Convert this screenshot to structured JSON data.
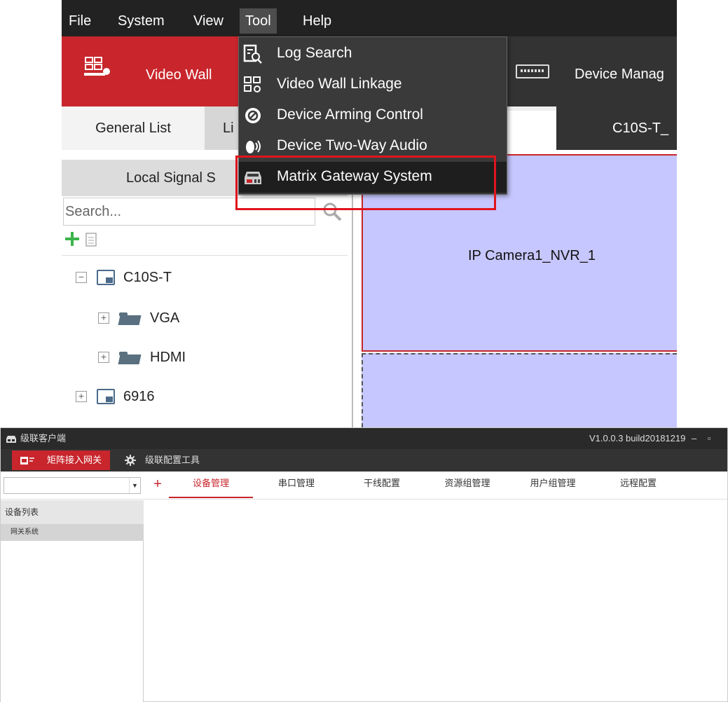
{
  "top": {
    "menubar": [
      "File",
      "System",
      "View",
      "Tool",
      "Help"
    ],
    "active_menu": "Tool",
    "modules": {
      "video_wall": "Video Wall",
      "device_management": "Device Manag"
    },
    "subtabs": {
      "general": "General List",
      "live": "Li",
      "c10s": "C10S-T_"
    },
    "left_panel": {
      "header": "Local Signal S",
      "search_placeholder": "Search...",
      "tree": [
        {
          "label": "C10S-T",
          "expander": "−"
        },
        {
          "label": "VGA",
          "expander": "+"
        },
        {
          "label": "HDMI",
          "expander": "+"
        },
        {
          "label": "6916",
          "expander": "+"
        }
      ]
    },
    "camera_tile_label": "IP Camera1_NVR_1",
    "tool_menu": [
      {
        "label": "Log Search",
        "icon": "log-search-icon"
      },
      {
        "label": "Video Wall Linkage",
        "icon": "video-wall-linkage-icon"
      },
      {
        "label": "Device Arming Control",
        "icon": "arming-control-icon"
      },
      {
        "label": "Device Two-Way Audio",
        "icon": "two-way-audio-icon"
      },
      {
        "label": "Matrix Gateway System",
        "icon": "matrix-gateway-icon"
      }
    ],
    "colors": {
      "accent": "#c8262c",
      "highlight_box": "#e0141e",
      "tile": "#c7c7ff"
    }
  },
  "app": {
    "title": "级联客户端",
    "version": "V1.0.0.3 build20181219",
    "window_controls": "– ▫ ×",
    "menu": {
      "matrix": "矩阵接入网关",
      "cascade": "级联配置工具"
    },
    "add_label": "+",
    "tabs": [
      "设备管理",
      "串口管理",
      "干线配置",
      "资源组管理",
      "用户组管理",
      "远程配置"
    ],
    "active_tab": "设备管理",
    "sidebar": {
      "header": "设备列表",
      "item": "网关系统"
    }
  }
}
